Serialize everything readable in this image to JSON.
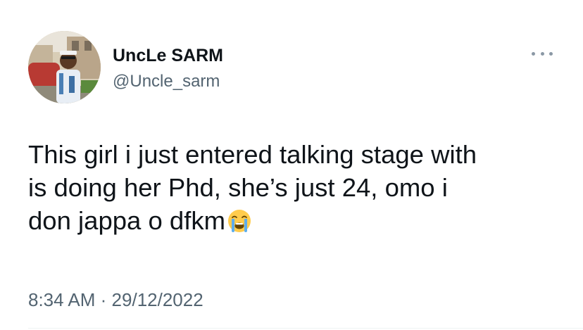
{
  "tweet": {
    "author": {
      "display_name": "UncLe SARM",
      "handle": "@Uncle_sarm",
      "avatar_icon": "profile-photo"
    },
    "more_icon": "ellipsis-icon",
    "text_lines": [
      "This girl i just entered talking stage with",
      "is doing her Phd, she’s just 24, omo i",
      "don jappa o dfkm"
    ],
    "emoji_icon": "loudly-crying-face-icon",
    "time": "8:34 AM",
    "separator": "·",
    "date": "29/12/2022"
  },
  "colors": {
    "text_primary": "#0f1419",
    "text_secondary": "#536471",
    "more_dots": "#8b98a5",
    "divider": "#eff3f4"
  }
}
